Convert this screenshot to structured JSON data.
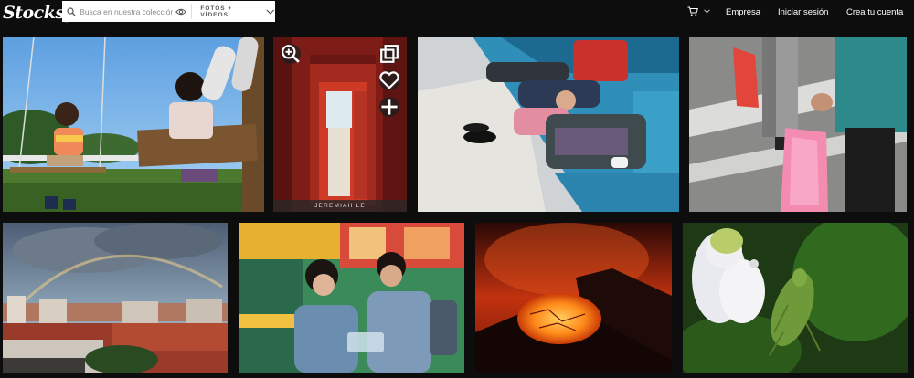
{
  "brand": {
    "logo_text": "Stocksy"
  },
  "search": {
    "placeholder": "Busca en nuestra colección",
    "filter_label": "FOTOS + VÍDEOS"
  },
  "nav": {
    "company": "Empresa",
    "login": "Iniciar sesión",
    "signup": "Crea tu cuenta"
  },
  "gallery": {
    "hovered_credit": "JEREMIAH LE",
    "photos": [
      {
        "subject": "children on a swing"
      },
      {
        "subject": "red doorway corridor"
      },
      {
        "subject": "family sleeping on airport seats"
      },
      {
        "subject": "hands carrying pink plastic bags"
      },
      {
        "subject": "rainbow over city apartments"
      },
      {
        "subject": "laughing couple with food container"
      },
      {
        "subject": "lava lake in volcano crater"
      },
      {
        "subject": "green weevil on flower"
      }
    ]
  },
  "colors": {
    "background": "#0d0d0d",
    "search_bg": "#ffffff"
  }
}
